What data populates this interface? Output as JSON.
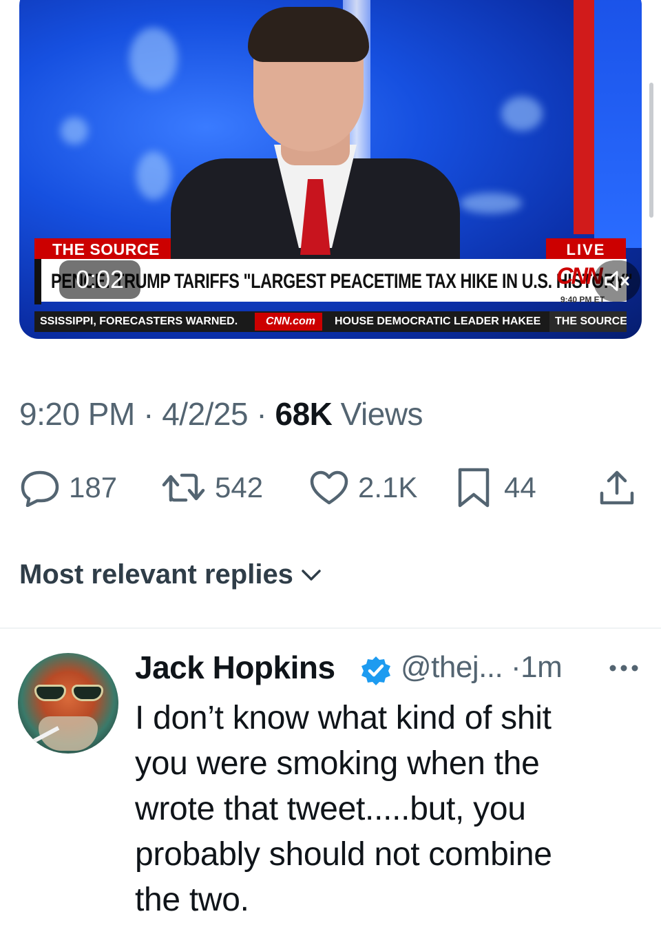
{
  "video": {
    "tag_source": "THE SOURCE",
    "tag_live": "LIVE",
    "headline": "PENCE: TRUMP TARIFFS \"LARGEST PEACETIME TAX HIKE IN U.S. HISTORY\"",
    "network_logo": "CNN",
    "network_time": "9:40 PM ET",
    "ticker_left": "SSISSIPPI, FORECASTERS WARNED.",
    "ticker_site": "CNN.com",
    "ticker_right": "HOUSE DEMOCRATIC LEADER HAKEE",
    "ticker_show": "THE SOURCE",
    "elapsed": "0:02",
    "muted": true
  },
  "tweet_meta": {
    "time": "9:20 PM",
    "sep1": "·",
    "date": "4/2/25",
    "sep2": "·",
    "views_count": "68K",
    "views_label": "Views"
  },
  "actions": {
    "replies": "187",
    "reposts": "542",
    "likes": "2.1K",
    "bookmarks": "44"
  },
  "replies_header": "Most relevant replies",
  "reply": {
    "name": "Jack Hopkins",
    "handle": "@thej...",
    "sep": "·",
    "age": "1m",
    "text_lines": [
      "I don’t know what kind of shit",
      "you were smoking when the",
      "wrote that tweet.....but, you",
      "probably should not combine",
      "the two."
    ]
  },
  "colors": {
    "secondary_text": "#536471",
    "verified_blue": "#1d9bf0",
    "cnn_red": "#cc0000"
  },
  "icons": [
    "reply-icon",
    "repost-icon",
    "like-icon",
    "bookmark-icon",
    "share-icon",
    "chevron-down-icon",
    "verified-icon",
    "more-icon",
    "mute-icon"
  ]
}
